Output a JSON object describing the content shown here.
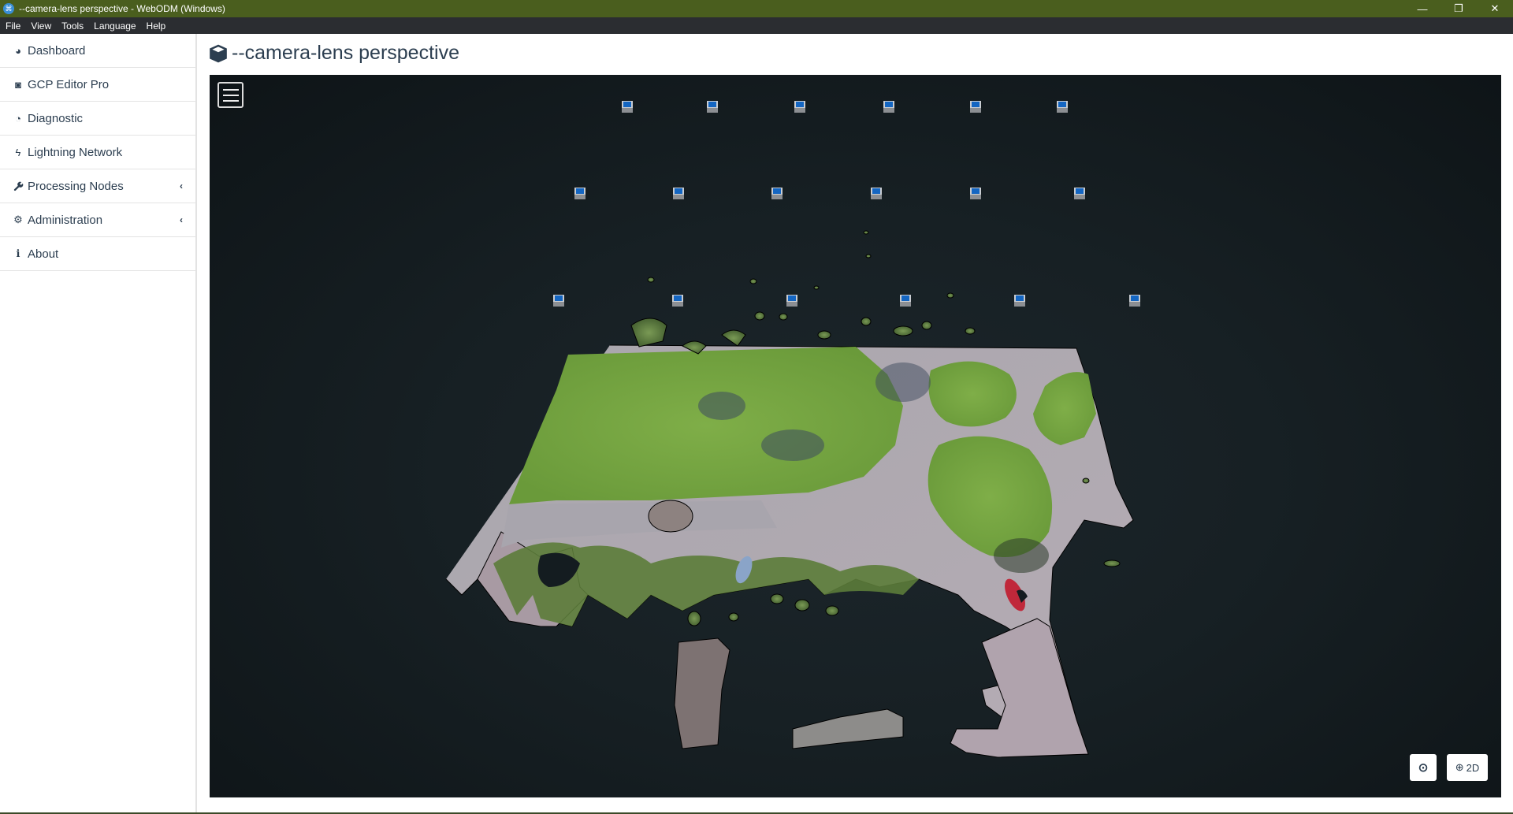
{
  "window": {
    "title": "--camera-lens perspective - WebODM (Windows)",
    "controls": {
      "minimize": "—",
      "restore": "❐",
      "close": "✕"
    }
  },
  "menubar": {
    "items": [
      "File",
      "View",
      "Tools",
      "Language",
      "Help"
    ]
  },
  "sidebar": {
    "items": [
      {
        "label": "Dashboard",
        "icon": "dashboard-icon",
        "glyph": "◕"
      },
      {
        "label": "GCP Editor Pro",
        "icon": "gcp-editor-icon",
        "glyph": "◙"
      },
      {
        "label": "Diagnostic",
        "icon": "pie-chart-icon",
        "glyph": "◔"
      },
      {
        "label": "Lightning Network",
        "icon": "lightning-icon",
        "glyph": "ϟ"
      },
      {
        "label": "Processing Nodes",
        "icon": "wrench-icon",
        "glyph": "🔧",
        "expandable": true
      },
      {
        "label": "Administration",
        "icon": "gears-icon",
        "glyph": "⚙",
        "expandable": true
      },
      {
        "label": "About",
        "icon": "info-icon",
        "glyph": "ℹ"
      }
    ],
    "chevron": "‹"
  },
  "page": {
    "title": "--camera-lens perspective",
    "icon": "cube-icon"
  },
  "viewer": {
    "menu_button": "menu",
    "download_icon": "⊙",
    "view2d_label": "2D",
    "globe_glyph": "⊕",
    "camera_count": 18
  }
}
